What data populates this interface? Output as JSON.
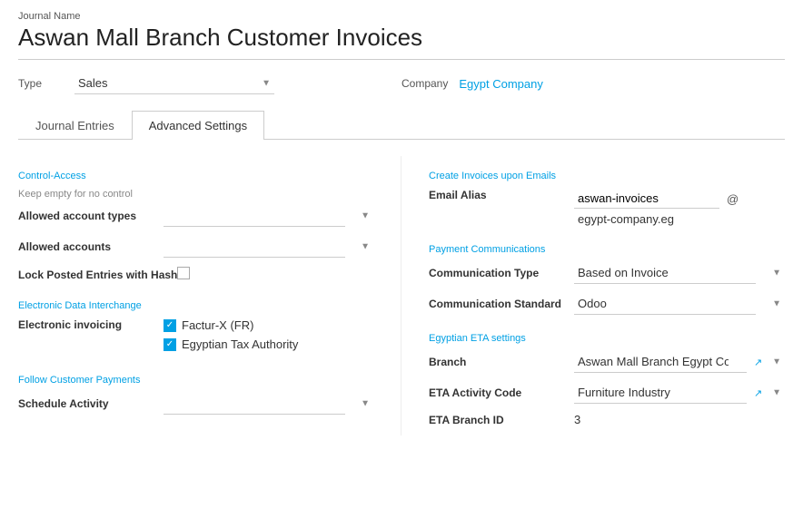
{
  "journal": {
    "name_label": "Journal Name",
    "title": "Aswan Mall Branch Customer Invoices"
  },
  "type_field": {
    "label": "Type",
    "value": "Sales"
  },
  "company_field": {
    "label": "Company",
    "value": "Egypt Company"
  },
  "tabs": [
    {
      "id": "journal-entries",
      "label": "Journal Entries",
      "active": false
    },
    {
      "id": "advanced-settings",
      "label": "Advanced Settings",
      "active": true
    }
  ],
  "left_panel": {
    "control_access": {
      "section_title": "Control-Access",
      "sub_label": "Keep empty for no control",
      "fields": [
        {
          "label": "Allowed account types",
          "value": ""
        },
        {
          "label": "Allowed accounts",
          "value": ""
        },
        {
          "label": "Lock Posted Entries with Hash",
          "type": "checkbox",
          "checked": false
        }
      ]
    },
    "electronic_data": {
      "section_title": "Electronic Data Interchange",
      "fields": [
        {
          "label": "Electronic invoicing",
          "checkboxes": [
            {
              "label": "Factur-X (FR)",
              "checked": true
            },
            {
              "label": "Egyptian Tax Authority",
              "checked": true
            }
          ]
        }
      ]
    },
    "follow_payments": {
      "section_title": "Follow Customer Payments",
      "fields": [
        {
          "label": "Schedule Activity",
          "value": ""
        }
      ]
    }
  },
  "right_panel": {
    "create_invoices": {
      "section_title": "Create Invoices upon Emails",
      "email_alias": {
        "label": "Email Alias",
        "alias_value": "aswan-invoices",
        "at": "@",
        "domain": "egypt-company.eg"
      }
    },
    "payment_communications": {
      "section_title": "Payment Communications",
      "fields": [
        {
          "label": "Communication Type",
          "value": "Based on Invoice"
        },
        {
          "label": "Communication Standard",
          "value": "Odoo"
        }
      ]
    },
    "egyptian_eta": {
      "section_title": "Egyptian ETA settings",
      "fields": [
        {
          "label": "Branch",
          "value": "Aswan Mall Branch Egypt Company",
          "has_link": true
        },
        {
          "label": "ETA Activity Code",
          "value": "Furniture Industry",
          "has_link": true
        },
        {
          "label": "ETA Branch ID",
          "value": "3"
        }
      ]
    }
  }
}
